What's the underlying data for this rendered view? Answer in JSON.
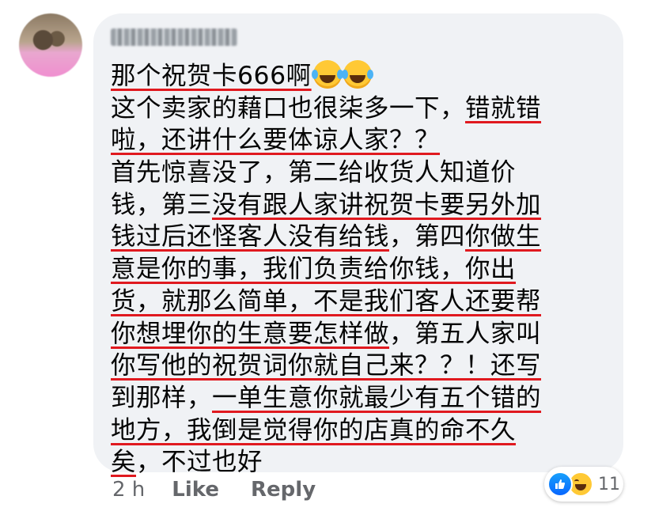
{
  "comment": {
    "author": "",
    "lines": [
      [
        {
          "t": "那个祝贺卡666啊",
          "u": true
        },
        {
          "emoji": "laughing-tears"
        },
        {
          "emoji": "laughing-tears"
        }
      ],
      [
        {
          "t": "这个卖家的藉口也很柒多一下，",
          "u": false
        },
        {
          "t": "错就错",
          "u": true
        }
      ],
      [
        {
          "t": "啦，还讲什么要体谅人家？？",
          "u": true
        }
      ],
      [
        {
          "t": "首先惊喜没了，第二给收货人知道价",
          "u": false
        }
      ],
      [
        {
          "t": "钱，第三",
          "u": false
        },
        {
          "t": "没有跟人家讲祝贺卡要另外加",
          "u": true
        }
      ],
      [
        {
          "t": "钱过后还怪客人没有给钱",
          "u": true
        },
        {
          "t": "，第四",
          "u": false
        },
        {
          "t": "你做生",
          "u": true
        }
      ],
      [
        {
          "t": "意是你的事，我们负责给你钱，你出",
          "u": true
        }
      ],
      [
        {
          "t": "货，就那么简单，不是我们客人还要帮",
          "u": true
        }
      ],
      [
        {
          "t": "你想埋你的生意要怎样做",
          "u": true
        },
        {
          "t": "，第五人家叫",
          "u": false
        }
      ],
      [
        {
          "t": "你写他的祝贺词你就自己来？？！还写",
          "u": true
        }
      ],
      [
        {
          "t": "到那样，",
          "u": false
        },
        {
          "t": "一单生意你就最少有五个错的",
          "u": true
        }
      ],
      [
        {
          "t": "地方，我倒是觉得你的店真的命不久",
          "u": true
        }
      ],
      [
        {
          "t": "矣",
          "u": true
        },
        {
          "t": "，不过也好",
          "u": false
        }
      ]
    ]
  },
  "meta": {
    "time": "2 h",
    "like_label": "Like",
    "reply_label": "Reply"
  },
  "reactions": {
    "icons": [
      "like-icon",
      "haha-icon"
    ],
    "count": "11"
  },
  "colors": {
    "bubble": "#f0f2f5",
    "underline": "#e0191f",
    "meta_text": "#65676b",
    "like_blue": "#0866ff"
  }
}
